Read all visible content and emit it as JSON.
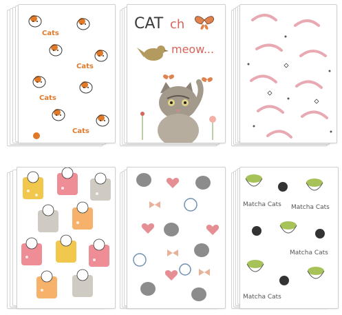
{
  "notebooks": [
    {
      "id": "calico-cats",
      "pattern_text": "Cats",
      "colors": {
        "accent": "#e07a2b",
        "ink": "#333333"
      }
    },
    {
      "id": "catch-meow",
      "title_part1": "CAT",
      "title_part2": "ch",
      "subtitle": "meow...",
      "colors": {
        "title": "#3a3a3a",
        "accent": "#d7645a",
        "butterfly": "#e0824e",
        "bird": "#b39a5e"
      }
    },
    {
      "id": "pink-cats",
      "colors": {
        "accent": "#e8a9b2",
        "ink": "#555555"
      }
    },
    {
      "id": "pocket-cats",
      "colors": {
        "yellow": "#f2c74e",
        "pink": "#ef8d96",
        "grey": "#cfcac2",
        "orange": "#f6b26b"
      }
    },
    {
      "id": "yarn-cats",
      "colors": {
        "heart": "#e58e93",
        "yarn": "#6d8fb3",
        "bow": "#e8b29a",
        "cat": "#8c8c8c"
      }
    },
    {
      "id": "matcha-cats",
      "pattern_text": "Matcha Cats",
      "colors": {
        "green": "#a8c25a",
        "cup": "#ffffff",
        "ink": "#333333"
      }
    }
  ]
}
